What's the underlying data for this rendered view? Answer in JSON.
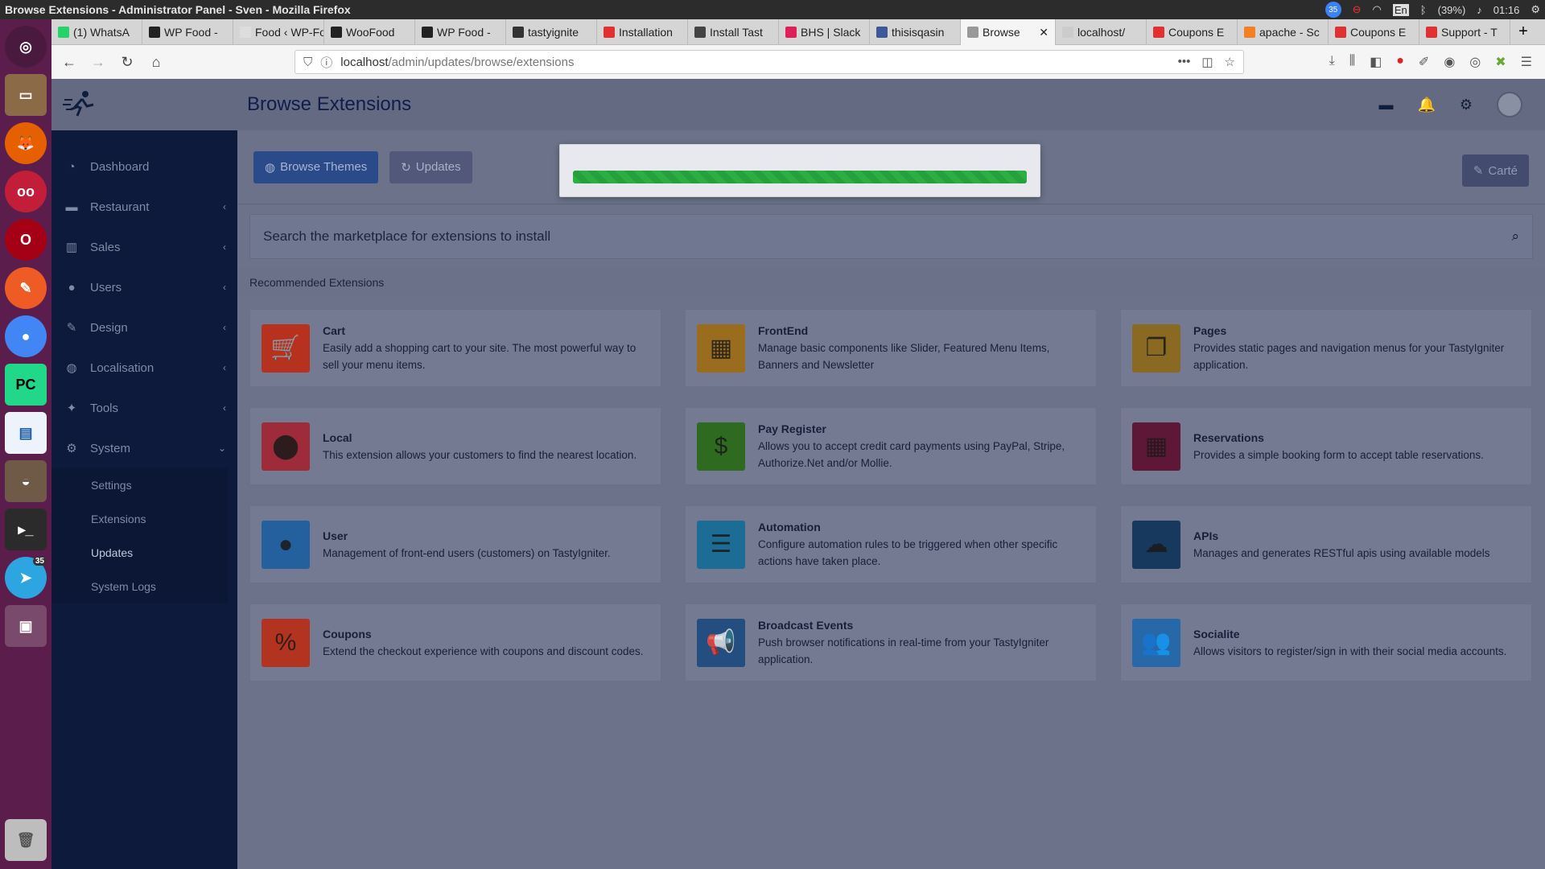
{
  "os": {
    "window_title": "Browse Extensions - Administrator Panel - Sven - Mozilla Firefox",
    "badge": "35",
    "lang": "En",
    "battery": "(39%)",
    "time": "01:16"
  },
  "launcher": {
    "telegram_count": "35"
  },
  "browser": {
    "tabs": [
      {
        "label": "(1) WhatsA",
        "color": "#25d366"
      },
      {
        "label": "WP Food -",
        "color": "#222222"
      },
      {
        "label": "Food ‹ WP-Fo",
        "color": "#dddddd"
      },
      {
        "label": "WooFood",
        "color": "#222222"
      },
      {
        "label": "WP Food -",
        "color": "#222222"
      },
      {
        "label": "tastyignite",
        "color": "#333333"
      },
      {
        "label": "Installation",
        "color": "#e23030"
      },
      {
        "label": "Install Tast",
        "color": "#444444"
      },
      {
        "label": "BHS | Slack",
        "color": "#e01e5a"
      },
      {
        "label": "thisisqasin",
        "color": "#3b5998"
      },
      {
        "label": "Browse",
        "color": "#999999",
        "active": true
      },
      {
        "label": "localhost/",
        "color": "#cccccc"
      },
      {
        "label": "Coupons E",
        "color": "#e23030"
      },
      {
        "label": "apache - Sc",
        "color": "#f48024"
      },
      {
        "label": "Coupons E",
        "color": "#e23030"
      },
      {
        "label": "Support - T",
        "color": "#e23030"
      }
    ],
    "url_host": "localhost",
    "url_path": "/admin/updates/browse/extensions"
  },
  "header": {
    "title": "Browse Extensions"
  },
  "sidebar": {
    "items": [
      {
        "label": "Dashboard",
        "icon": "dashboard-icon",
        "glyph": "◔",
        "chevron": ""
      },
      {
        "label": "Restaurant",
        "icon": "store-icon",
        "glyph": "▬",
        "chevron": "‹"
      },
      {
        "label": "Sales",
        "icon": "chart-icon",
        "glyph": "▥",
        "chevron": "‹"
      },
      {
        "label": "Users",
        "icon": "user-icon",
        "glyph": "●",
        "chevron": "‹"
      },
      {
        "label": "Design",
        "icon": "brush-icon",
        "glyph": "✎",
        "chevron": "‹"
      },
      {
        "label": "Localisation",
        "icon": "globe-icon",
        "glyph": "◍",
        "chevron": "‹"
      },
      {
        "label": "Tools",
        "icon": "wrench-icon",
        "glyph": "✦",
        "chevron": "‹"
      },
      {
        "label": "System",
        "icon": "cogs-icon",
        "glyph": "⚙",
        "chevron": "⌄"
      }
    ],
    "sub_items": [
      "Settings",
      "Extensions",
      "Updates",
      "System Logs"
    ]
  },
  "toolbar": {
    "browse_themes": "Browse Themes",
    "updates": "Updates",
    "carte": "Carté"
  },
  "search": {
    "placeholder": "Search the marketplace for extensions to install"
  },
  "recommended": {
    "heading": "Recommended Extensions",
    "extensions": [
      {
        "name": "Cart",
        "desc": "Easily add a shopping cart to your site. The most powerful way to sell your menu items.",
        "icon": "cart-icon",
        "glyph": "🛒",
        "color": "#b7321e"
      },
      {
        "name": "FrontEnd",
        "desc": "Manage basic components like Slider, Featured Menu Items, Banners and Newsletter",
        "icon": "store-front-icon",
        "glyph": "▦",
        "color": "#9a6d1e"
      },
      {
        "name": "Pages",
        "desc": "Provides static pages and navigation menus for your TastyIgniter application.",
        "icon": "copy-icon",
        "glyph": "❐",
        "color": "#8a6a22"
      },
      {
        "name": "Local",
        "desc": "This extension allows your customers to find the nearest location.",
        "icon": "map-marker-icon",
        "glyph": "⬤",
        "color": "#9e2b3a"
      },
      {
        "name": "Pay Register",
        "desc": "Allows you to accept credit card payments using PayPal, Stripe, Authorize.Net and/or Mollie.",
        "icon": "money-bill-icon",
        "glyph": "$",
        "color": "#2e6a20"
      },
      {
        "name": "Reservations",
        "desc": "Provides a simple booking form to accept table reservations.",
        "icon": "calendar-icon",
        "glyph": "▦",
        "color": "#5e1737"
      },
      {
        "name": "User",
        "desc": "Management of front-end users (customers) on TastyIgniter.",
        "icon": "user-icon",
        "glyph": "●",
        "color": "#24609e"
      },
      {
        "name": "Automation",
        "desc": "Configure automation rules to be triggered when other specific actions have taken place.",
        "icon": "tasks-icon",
        "glyph": "☰",
        "color": "#1d6c96"
      },
      {
        "name": "APIs",
        "desc": "Manages and generates RESTful apis using available models",
        "icon": "cloud-icon",
        "glyph": "☁",
        "color": "#17395e"
      },
      {
        "name": "Coupons",
        "desc": "Extend the checkout experience with coupons and discount codes.",
        "icon": "percent-icon",
        "glyph": "%",
        "color": "#b23420"
      },
      {
        "name": "Broadcast Events",
        "desc": "Push browser notifications in real-time from your TastyIgniter application.",
        "icon": "bullhorn-icon",
        "glyph": "📢",
        "color": "#244e80"
      },
      {
        "name": "Socialite",
        "desc": "Allows visitors to register/sign in with their social media accounts.",
        "icon": "users-icon",
        "glyph": "👥",
        "color": "#2668a8"
      }
    ]
  },
  "modal": {
    "progress": 1.0
  }
}
